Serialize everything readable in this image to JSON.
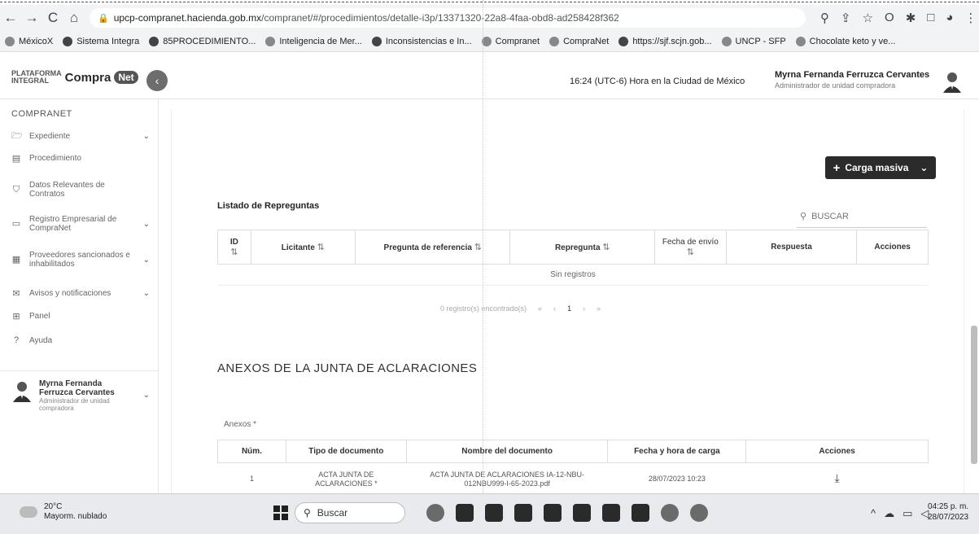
{
  "browser": {
    "url_host": "upcp-compranet.hacienda.gob.mx",
    "url_path": "/compranet/#/procedimientos/detalle-i3p/13371320-22a8-4faa-obd8-ad258428f362",
    "bookmarks": [
      "MéxicoX",
      "Sistema Integra",
      "85PROCEDIMIENTO...",
      "Inteligencia de Mer...",
      "Inconsistencias e In...",
      "Compranet",
      "CompraNet",
      "https://sjf.scjn.gob...",
      "UNCP - SFP",
      "Chocolate keto y ve..."
    ]
  },
  "header": {
    "logo_top": "PLATAFORMA",
    "logo_bottom": "INTEGRAL",
    "logo_compra": "Compra",
    "logo_net": "Net",
    "clock": "16:24 (UTC-6) Hora en la Ciudad de México",
    "user_name": "Myrna Fernanda Ferruzca Cervantes",
    "user_role": "Administrador de unidad compradora"
  },
  "sidebar": {
    "title": "COMPRANET",
    "items": [
      {
        "label": "Expediente",
        "icon": "folder-icon"
      },
      {
        "label": "Procedimiento",
        "icon": "document-icon"
      },
      {
        "label": "Datos Relevantes de Contratos",
        "icon": "bookmark-icon"
      },
      {
        "label": "Registro Empresarial de CompraNet",
        "icon": "id-card-icon"
      },
      {
        "label": "Proveedores sancionados e inhabilitados",
        "icon": "calendar-icon"
      },
      {
        "label": "Avisos y notificaciones",
        "icon": "mail-icon"
      },
      {
        "label": "Panel",
        "icon": "grid-icon"
      },
      {
        "label": "Ayuda",
        "icon": "help-icon"
      }
    ],
    "user_name": "Myrna Fernanda Ferruzca Cervantes",
    "user_role": "Administrador de unidad compradora"
  },
  "main": {
    "carga_label": "Carga masiva",
    "list_title": "Listado de Repreguntas",
    "search_placeholder": "BUSCAR",
    "repreguntas_headers": [
      "ID",
      "Licitante",
      "Pregunta de referencia",
      "Repregunta",
      "Fecha de envío",
      "Respuesta",
      "Acciones"
    ],
    "empty_text": "Sin registros",
    "pager_text": "0 registro(s) encontrado(s)",
    "pager_page": "1",
    "anexos_title": "ANEXOS DE LA JUNTA DE ACLARACIONES",
    "anexos_label": "Anexos *",
    "anexos_headers": [
      "Núm.",
      "Tipo de documento",
      "Nombre del documento",
      "Fecha y hora de carga",
      "Acciones"
    ],
    "anexos_rows": [
      {
        "num": "1",
        "tipo": "ACTA JUNTA DE ACLARACIONES *",
        "nombre": "ACTA JUNTA DE ACLARACIONES IA-12-NBU-012NBU999-I-65-2023.pdf",
        "fecha": "28/07/2023 10:23"
      }
    ]
  },
  "taskbar": {
    "temp": "20°C",
    "weather": "Mayorm. nublado",
    "search": "Buscar",
    "time": "04:25 p. m.",
    "date": "28/07/2023"
  }
}
